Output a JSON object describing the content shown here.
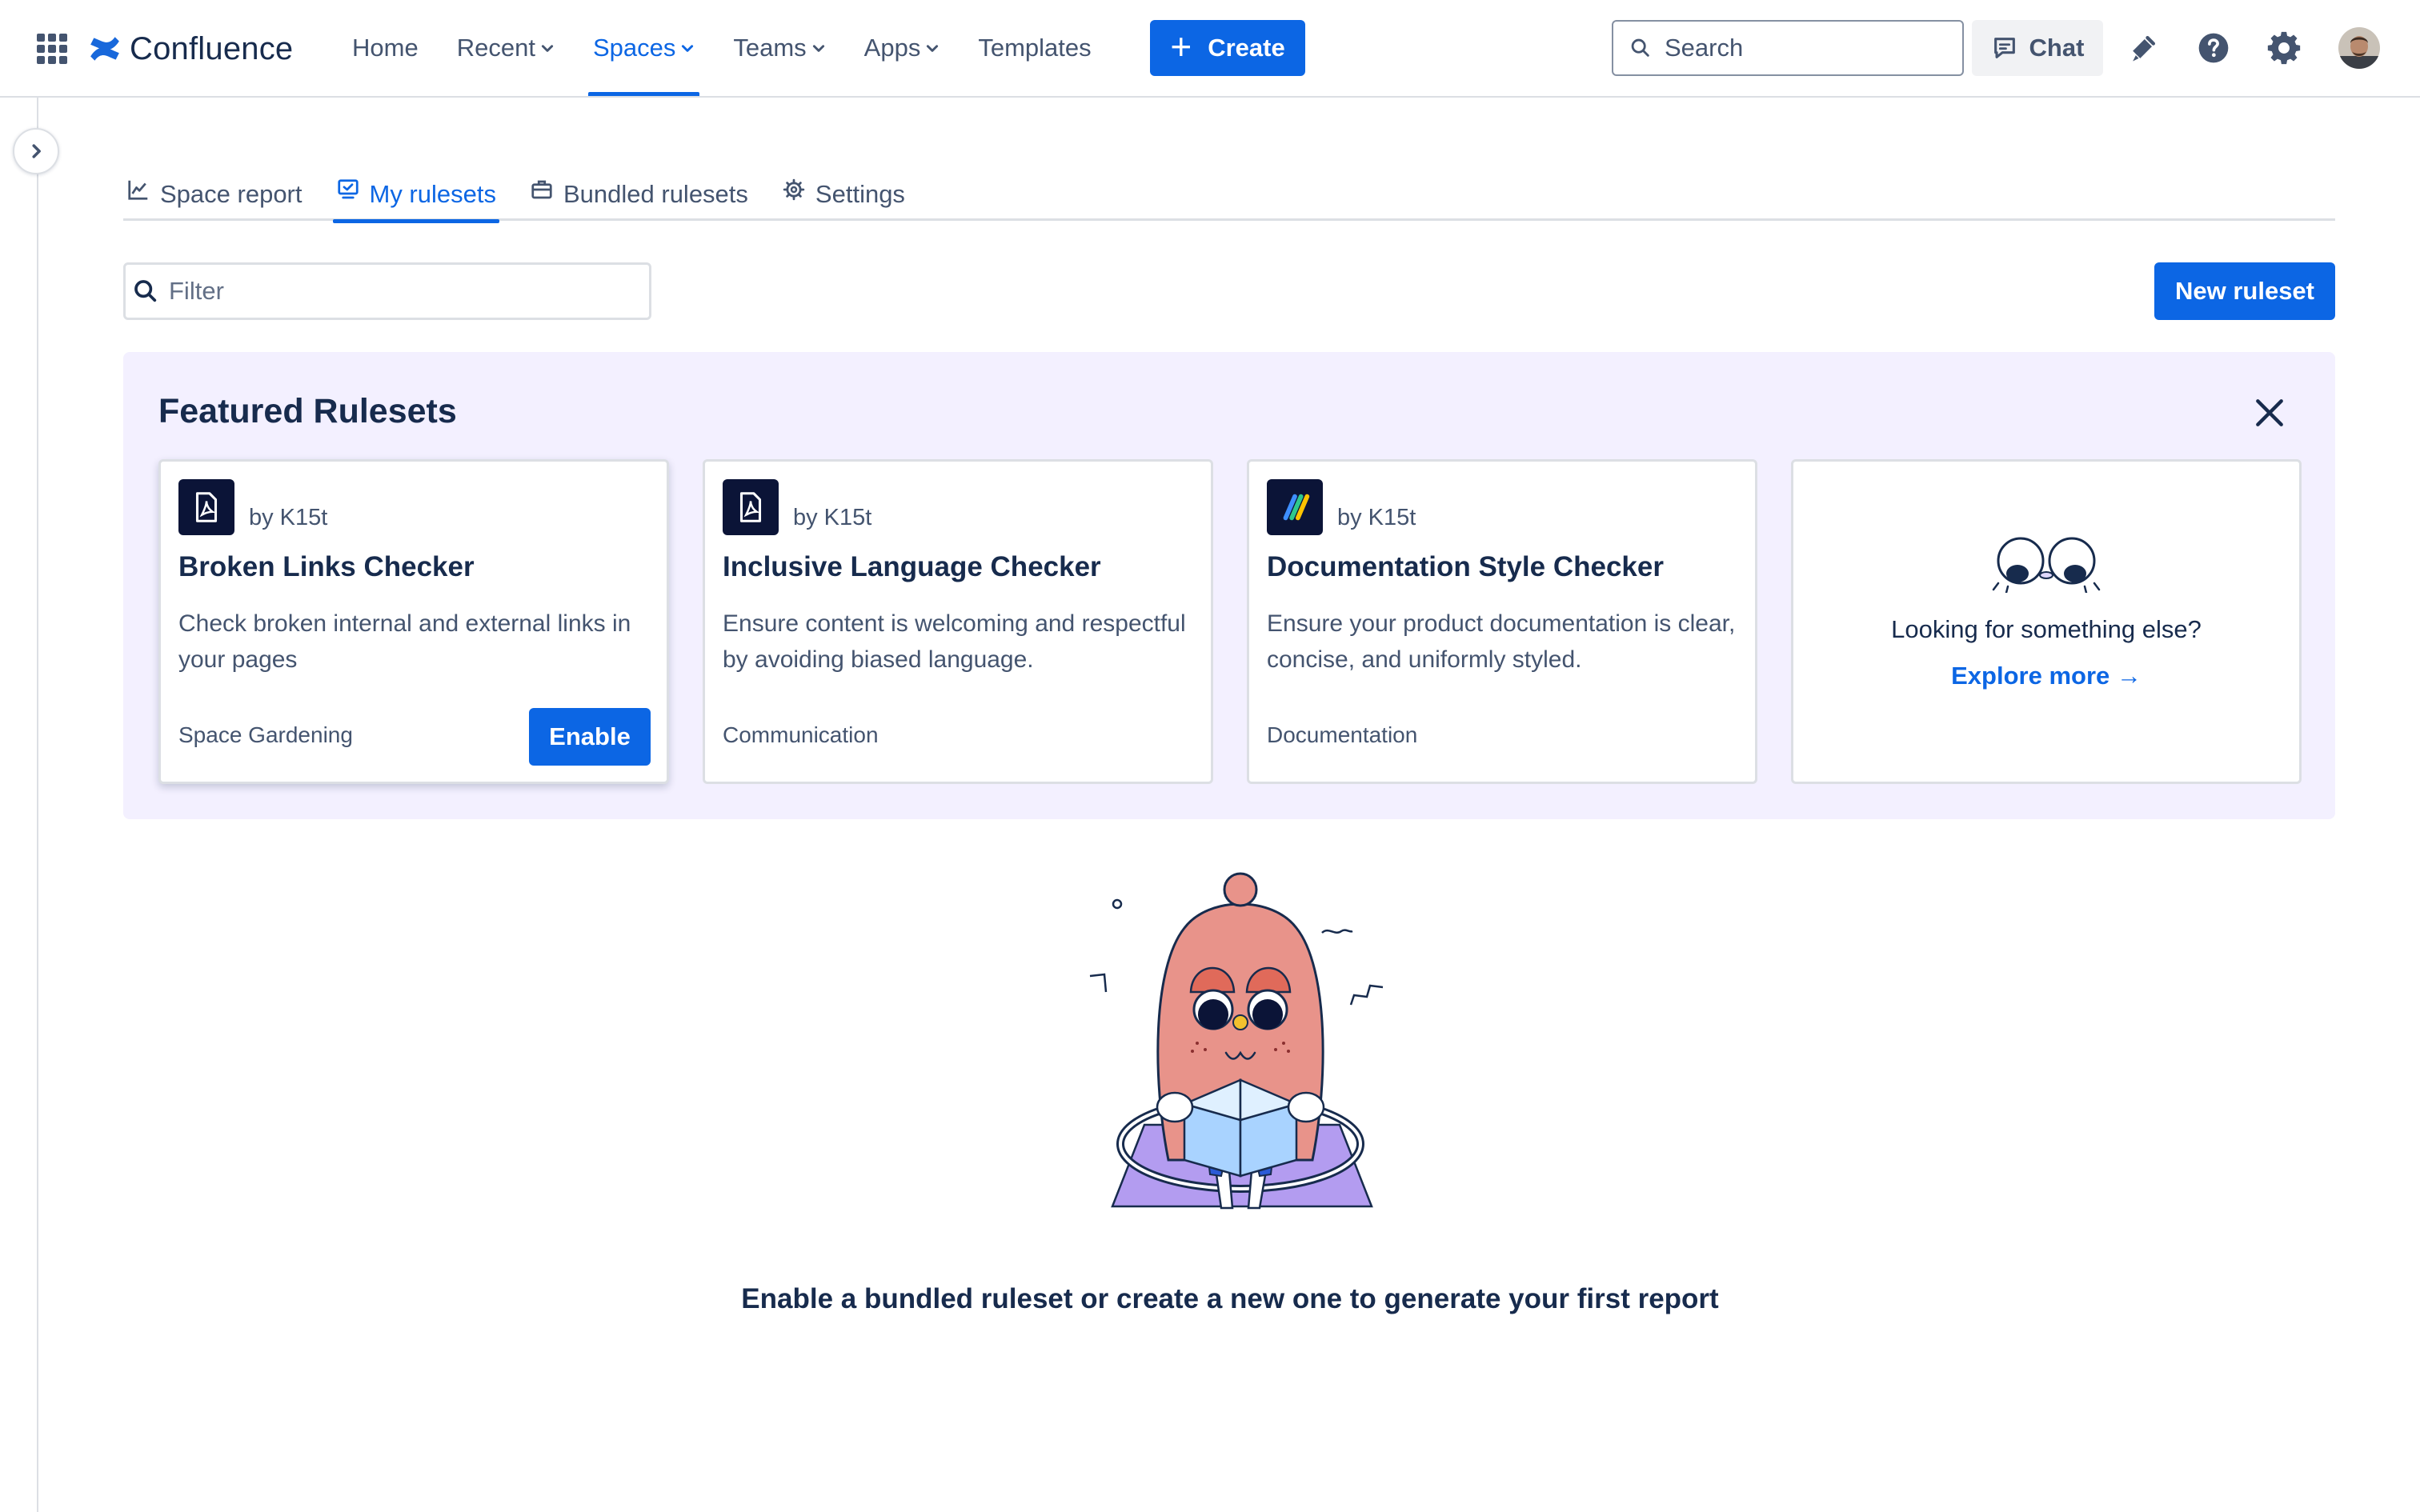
{
  "app": {
    "name": "Confluence"
  },
  "topnav": {
    "items": [
      {
        "label": "Home",
        "has_menu": false,
        "active": false
      },
      {
        "label": "Recent",
        "has_menu": true,
        "active": false
      },
      {
        "label": "Spaces",
        "has_menu": true,
        "active": true
      },
      {
        "label": "Teams",
        "has_menu": true,
        "active": false
      },
      {
        "label": "Apps",
        "has_menu": true,
        "active": false
      },
      {
        "label": "Templates",
        "has_menu": false,
        "active": false
      }
    ],
    "create_label": "Create",
    "search_placeholder": "Search",
    "chat_label": "Chat"
  },
  "tabs": [
    {
      "label": "Space report",
      "icon": "line-chart-icon",
      "active": false
    },
    {
      "label": "My rulesets",
      "icon": "monitor-check-icon",
      "active": true
    },
    {
      "label": "Bundled rulesets",
      "icon": "briefcase-icon",
      "active": false
    },
    {
      "label": "Settings",
      "icon": "gear-icon",
      "active": false
    }
  ],
  "toolbar": {
    "filter_placeholder": "Filter",
    "new_ruleset_label": "New ruleset"
  },
  "featured": {
    "title": "Featured Rulesets",
    "cards": [
      {
        "by": "by K15t",
        "title": "Broken Links Checker",
        "description": "Check broken internal and external links in your pages",
        "category": "Space Gardening",
        "action_label": "Enable"
      },
      {
        "by": "by K15t",
        "title": "Inclusive Language Checker",
        "description": "Ensure content is welcoming and respectful by avoiding biased language.",
        "category": "Communication"
      },
      {
        "by": "by K15t",
        "title": "Documentation Style Checker",
        "description": "Ensure your product documentation is clear, concise, and uniformly styled.",
        "category": "Documentation"
      }
    ],
    "more": {
      "text": "Looking for something else?",
      "link_label": "Explore more →"
    }
  },
  "empty_state": {
    "message": "Enable a bundled ruleset or create a new one to generate your first report"
  },
  "colors": {
    "brand_blue": "#0c66e4",
    "featured_bg": "#f3f0ff",
    "text_primary": "#172b4d",
    "text_subtle": "#44546f"
  }
}
